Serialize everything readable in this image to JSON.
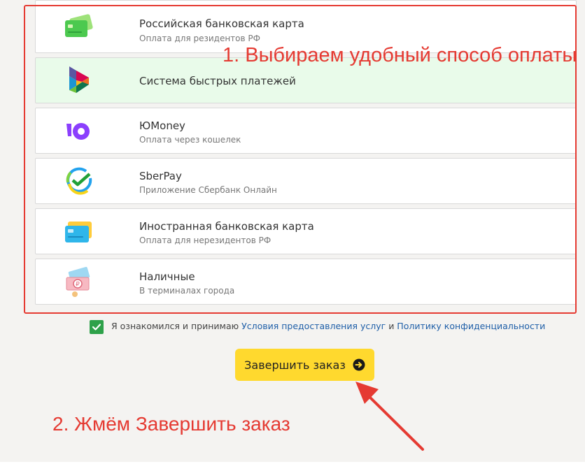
{
  "payment_methods": [
    {
      "title": "Российская банковская карта",
      "subtitle": "Оплата для резидентов РФ",
      "icon": "green-bank-card-icon"
    },
    {
      "title": "Система быстрых платежей",
      "subtitle": "",
      "icon": "sbp-logo-icon",
      "selected": true
    },
    {
      "title": "ЮMoney",
      "subtitle": "Оплата через кошелек",
      "icon": "yoomoney-logo-icon"
    },
    {
      "title": "SberPay",
      "subtitle": "Приложение Сбербанк Онлайн",
      "icon": "sberpay-logo-icon"
    },
    {
      "title": "Иностранная банковская карта",
      "subtitle": "Оплата для нерезидентов РФ",
      "icon": "foreign-bank-card-icon"
    },
    {
      "title": "Наличные",
      "subtitle": "В терминалах города",
      "icon": "cash-icon"
    }
  ],
  "annotations": {
    "step1": "1. Выбираем удобный способ оплаты",
    "step2": "2. Жмём Завершить заказ"
  },
  "consent": {
    "checked": true,
    "text_before": "Я ознакомился и принимаю",
    "terms_link": "Условия предоставления услуг",
    "conjunction": "и",
    "privacy_link": "Политику конфиденциальности"
  },
  "submit_button": {
    "label": "Завершить заказ",
    "icon": "arrow-right-circle-icon"
  },
  "colors": {
    "annotation_red": "#e53a32",
    "selected_bg": "#e9fbea",
    "button_yellow": "#ffd92e",
    "checkbox_green": "#2ea14a",
    "link_blue": "#1f5fa8"
  }
}
